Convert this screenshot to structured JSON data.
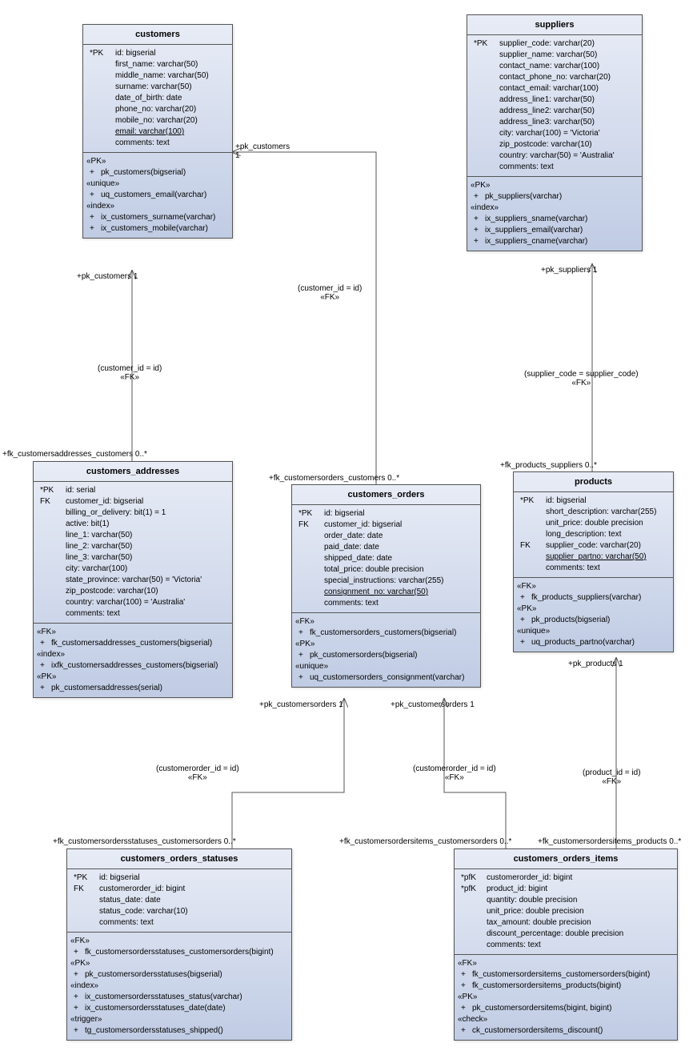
{
  "entities": {
    "customers": {
      "title": "customers",
      "cols": [
        {
          "pre": "*PK",
          "t": "id: bigserial"
        },
        {
          "pre": "",
          "t": "first_name: varchar(50)"
        },
        {
          "pre": "",
          "t": "middle_name: varchar(50)"
        },
        {
          "pre": "",
          "t": "surname: varchar(50)"
        },
        {
          "pre": "",
          "t": "date_of_birth: date"
        },
        {
          "pre": "",
          "t": "phone_no: varchar(20)"
        },
        {
          "pre": "",
          "t": "mobile_no: varchar(20)"
        },
        {
          "pre": "",
          "t": "email: varchar(100)",
          "u": true
        },
        {
          "pre": "",
          "t": "comments: text"
        }
      ],
      "ops": [
        {
          "s": "«PK»",
          "items": [
            "pk_customers(bigserial)"
          ]
        },
        {
          "s": "«unique»",
          "items": [
            "uq_customers_email(varchar)"
          ]
        },
        {
          "s": "«index»",
          "items": [
            "ix_customers_surname(varchar)",
            "ix_customers_mobile(varchar)"
          ]
        }
      ]
    },
    "suppliers": {
      "title": "suppliers",
      "cols": [
        {
          "pre": "*PK",
          "t": "supplier_code: varchar(20)"
        },
        {
          "pre": "",
          "t": "supplier_name: varchar(50)"
        },
        {
          "pre": "",
          "t": "contact_name: varchar(100)"
        },
        {
          "pre": "",
          "t": "contact_phone_no: varchar(20)"
        },
        {
          "pre": "",
          "t": "contact_email: varchar(100)"
        },
        {
          "pre": "",
          "t": "address_line1: varchar(50)"
        },
        {
          "pre": "",
          "t": "address_line2: varchar(50)"
        },
        {
          "pre": "",
          "t": "address_line3: varchar(50)"
        },
        {
          "pre": "",
          "t": "city: varchar(100) = 'Victoria'"
        },
        {
          "pre": "",
          "t": "zip_postcode: varchar(10)"
        },
        {
          "pre": "",
          "t": "country: varchar(50) = 'Australia'"
        },
        {
          "pre": "",
          "t": "comments: text"
        }
      ],
      "ops": [
        {
          "s": "«PK»",
          "items": [
            "pk_suppliers(varchar)"
          ]
        },
        {
          "s": "«index»",
          "items": [
            "ix_suppliers_sname(varchar)",
            "ix_suppliers_email(varchar)",
            "ix_suppliers_cname(varchar)"
          ]
        }
      ]
    },
    "customers_addresses": {
      "title": "customers_addresses",
      "cols": [
        {
          "pre": "*PK",
          "t": "id: serial"
        },
        {
          "pre": "FK",
          "t": "customer_id: bigserial"
        },
        {
          "pre": "",
          "t": "billing_or_delivery: bit(1) = 1"
        },
        {
          "pre": "",
          "t": "active: bit(1)"
        },
        {
          "pre": "",
          "t": "line_1: varchar(50)"
        },
        {
          "pre": "",
          "t": "line_2: varchar(50)"
        },
        {
          "pre": "",
          "t": "line_3: varchar(50)"
        },
        {
          "pre": "",
          "t": "city: varchar(100)"
        },
        {
          "pre": "",
          "t": "state_province: varchar(50) = 'Victoria'"
        },
        {
          "pre": "",
          "t": "zip_postcode: varchar(10)"
        },
        {
          "pre": "",
          "t": "country: varchar(100) = 'Australia'"
        },
        {
          "pre": "",
          "t": "comments: text"
        }
      ],
      "ops": [
        {
          "s": "«FK»",
          "items": [
            "fk_customersaddresses_customers(bigserial)"
          ]
        },
        {
          "s": "«index»",
          "items": [
            "ixfk_customersaddresses_customers(bigserial)"
          ]
        },
        {
          "s": "«PK»",
          "items": [
            "pk_customersaddresses(serial)"
          ]
        }
      ]
    },
    "customers_orders": {
      "title": "customers_orders",
      "cols": [
        {
          "pre": "*PK",
          "t": "id: bigserial"
        },
        {
          "pre": "FK",
          "t": "customer_id: bigserial"
        },
        {
          "pre": "",
          "t": "order_date: date"
        },
        {
          "pre": "",
          "t": "paid_date: date"
        },
        {
          "pre": "",
          "t": "shipped_date: date"
        },
        {
          "pre": "",
          "t": "total_price: double precision"
        },
        {
          "pre": "",
          "t": "special_instructions: varchar(255)"
        },
        {
          "pre": "",
          "t": "consignment_no: varchar(50)",
          "u": true
        },
        {
          "pre": "",
          "t": "comments: text"
        }
      ],
      "ops": [
        {
          "s": "«FK»",
          "items": [
            "fk_customersorders_customers(bigserial)"
          ]
        },
        {
          "s": "«PK»",
          "items": [
            "pk_customersorders(bigserial)"
          ]
        },
        {
          "s": "«unique»",
          "items": [
            "uq_customersorders_consignment(varchar)"
          ]
        }
      ]
    },
    "products": {
      "title": "products",
      "cols": [
        {
          "pre": "*PK",
          "t": "id: bigserial"
        },
        {
          "pre": "",
          "t": "short_description: varchar(255)"
        },
        {
          "pre": "",
          "t": "unit_price: double precision"
        },
        {
          "pre": "",
          "t": "long_description: text"
        },
        {
          "pre": "FK",
          "t": "supplier_code: varchar(20)"
        },
        {
          "pre": "",
          "t": "supplier_partno: varchar(50)",
          "u": true
        },
        {
          "pre": "",
          "t": "comments: text"
        }
      ],
      "ops": [
        {
          "s": "«FK»",
          "items": [
            "fk_products_suppliers(varchar)"
          ]
        },
        {
          "s": "«PK»",
          "items": [
            "pk_products(bigserial)"
          ]
        },
        {
          "s": "«unique»",
          "items": [
            "uq_products_partno(varchar)"
          ]
        }
      ]
    },
    "customers_orders_statuses": {
      "title": "customers_orders_statuses",
      "cols": [
        {
          "pre": "*PK",
          "t": "id: bigserial"
        },
        {
          "pre": "FK",
          "t": "customerorder_id: bigint"
        },
        {
          "pre": "",
          "t": "status_date: date"
        },
        {
          "pre": "",
          "t": "status_code: varchar(10)"
        },
        {
          "pre": "",
          "t": "comments: text"
        }
      ],
      "ops": [
        {
          "s": "«FK»",
          "items": [
            "fk_customersordersstatuses_customersorders(bigint)"
          ]
        },
        {
          "s": "«PK»",
          "items": [
            "pk_customersordersstatuses(bigserial)"
          ]
        },
        {
          "s": "«index»",
          "items": [
            "ix_customersordersstatuses_status(varchar)",
            "ix_customersordersstatuses_date(date)"
          ]
        },
        {
          "s": "«trigger»",
          "items": [
            "tg_customersordersstatuses_shipped()"
          ]
        }
      ]
    },
    "customers_orders_items": {
      "title": "customers_orders_items",
      "cols": [
        {
          "pre": "*pfK",
          "t": "customerorder_id: bigint"
        },
        {
          "pre": "*pfK",
          "t": "product_id: bigint"
        },
        {
          "pre": "",
          "t": "quantity: double precision"
        },
        {
          "pre": "",
          "t": "unit_price: double precision"
        },
        {
          "pre": "",
          "t": "tax_amount: double precision"
        },
        {
          "pre": "",
          "t": "discount_percentage: double precision"
        },
        {
          "pre": "",
          "t": "comments: text"
        }
      ],
      "ops": [
        {
          "s": "«FK»",
          "items": [
            "fk_customersordersitems_customersorders(bigint)",
            "fk_customersordersitems_products(bigint)"
          ]
        },
        {
          "s": "«PK»",
          "items": [
            "pk_customersordersitems(bigint, bigint)"
          ]
        },
        {
          "s": "«check»",
          "items": [
            "ck_customersordersitems_discount()"
          ]
        }
      ]
    }
  },
  "labels": {
    "l1": "+pk_customers",
    "l1m": "1",
    "l2": "(customer_id = id)",
    "l2f": "«FK»",
    "l3": "+fk_customersaddresses_customers",
    "l3m": "0..*",
    "l4": "+pk_customers",
    "l4m": "1",
    "l5": "(customer_id = id)",
    "l5f": "«FK»",
    "l6": "+fk_customersorders_customers",
    "l6m": "0..*",
    "l7": "+pk_suppliers",
    "l7m": "1",
    "l8": "(supplier_code = supplier_code)",
    "l8f": "«FK»",
    "l9": "+fk_products_suppliers",
    "l9m": "0..*",
    "l10": "+pk_customersorders",
    "l10m": "1",
    "l11": "+pk_customersorders",
    "l11m": "1",
    "l12": "(customerorder_id = id)",
    "l12f": "«FK»",
    "l13": "+fk_customersordersstatuses_customersorders",
    "l13m": "0..*",
    "l14": "(customerorder_id = id)",
    "l14f": "«FK»",
    "l15": "+fk_customersordersitems_customersorders",
    "l15m": "0..*",
    "l16": "+pk_products",
    "l16m": "1",
    "l17": "(product_id = id)",
    "l17f": "«FK»",
    "l18": "+fk_customersordersitems_products",
    "l18m": "0..*"
  }
}
